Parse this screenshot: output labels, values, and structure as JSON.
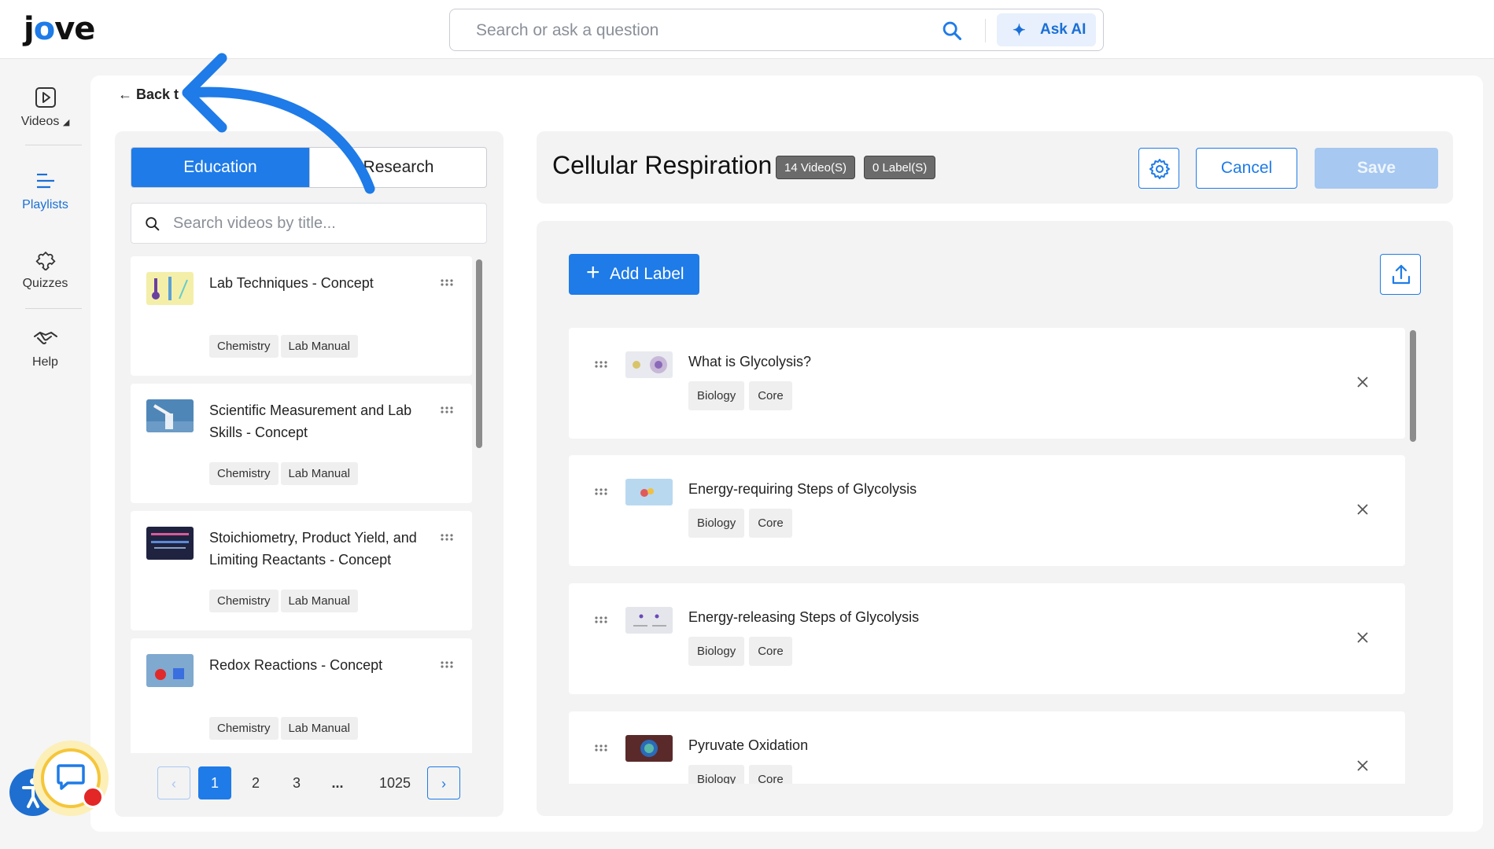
{
  "header": {
    "logo": "jove",
    "search_placeholder": "Search or ask a question",
    "ask_ai_label": "Ask AI"
  },
  "nav": {
    "items": [
      {
        "label": "Videos",
        "icon": "play-icon"
      },
      {
        "label": "Playlists",
        "icon": "list-icon",
        "active": true
      },
      {
        "label": "Quizzes",
        "icon": "puzzle-icon"
      },
      {
        "label": "Help",
        "icon": "handshake-icon"
      }
    ]
  },
  "back_label": "Back t",
  "library": {
    "tabs": [
      "Education",
      "Research"
    ],
    "active_tab": "Education",
    "search_placeholder": "Search videos by title...",
    "videos": [
      {
        "title": "Lab Techniques - Concept",
        "tags": [
          "Chemistry",
          "Lab Manual"
        ]
      },
      {
        "title": "Scientific Measurement and Lab Skills - Concept",
        "tags": [
          "Chemistry",
          "Lab Manual"
        ]
      },
      {
        "title": "Stoichiometry, Product Yield, and Limiting Reactants - Concept",
        "tags": [
          "Chemistry",
          "Lab Manual"
        ]
      },
      {
        "title": "Redox Reactions - Concept",
        "tags": [
          "Chemistry",
          "Lab Manual"
        ]
      }
    ],
    "pagination": {
      "pages": [
        "1",
        "2",
        "3",
        "...",
        "1025"
      ],
      "current": "1",
      "prev": "‹",
      "next": "›"
    }
  },
  "playlist": {
    "title": "Cellular Respiration",
    "videos_badge": "14 Video(S)",
    "labels_badge": "0 Label(S)",
    "cancel_label": "Cancel",
    "save_label": "Save",
    "add_label": "Add Label",
    "add_plus": "+",
    "items": [
      {
        "title": "What is Glycolysis?",
        "tags": [
          "Biology",
          "Core"
        ]
      },
      {
        "title": "Energy-requiring Steps of Glycolysis",
        "tags": [
          "Biology",
          "Core"
        ]
      },
      {
        "title": "Energy-releasing Steps of Glycolysis",
        "tags": [
          "Biology",
          "Core"
        ]
      },
      {
        "title": "Pyruvate Oxidation",
        "tags": [
          "Biology",
          "Core"
        ]
      }
    ]
  },
  "colors": {
    "accent": "#1e7be8",
    "annotation_arrow": "#1e7be8",
    "save_disabled": "#a6c8f1"
  }
}
